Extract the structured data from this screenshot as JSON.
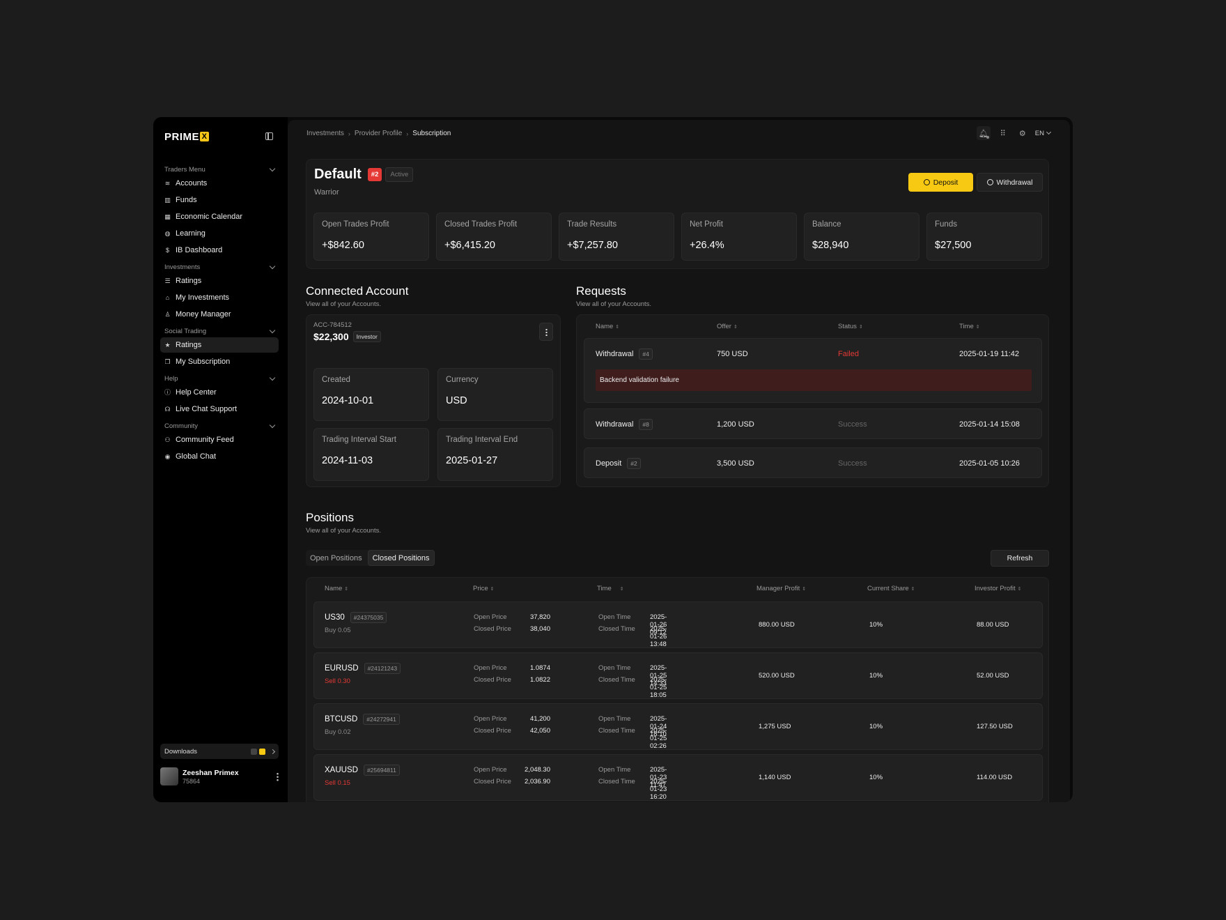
{
  "sidebar": {
    "logo_text": "PRIME",
    "logo_accent": "X",
    "sections": [
      {
        "title": "Traders Menu",
        "items": [
          {
            "label": "Accounts",
            "icon": "layers-icon"
          },
          {
            "label": "Funds",
            "icon": "chart-icon"
          },
          {
            "label": "Economic Calendar",
            "icon": "calendar-icon"
          },
          {
            "label": "Learning",
            "icon": "globe-icon"
          },
          {
            "label": "IB Dashboard",
            "icon": "dollar-icon"
          }
        ]
      },
      {
        "title": "Investments",
        "items": [
          {
            "label": "Ratings",
            "icon": "list-icon"
          },
          {
            "label": "My Investments",
            "icon": "bank-icon"
          },
          {
            "label": "Money Manager",
            "icon": "manager-icon"
          }
        ]
      },
      {
        "title": "Social Trading",
        "items": [
          {
            "label": "Ratings",
            "icon": "star-icon",
            "active": true
          },
          {
            "label": "My Subscription",
            "icon": "subscription-icon"
          }
        ]
      },
      {
        "title": "Help",
        "items": [
          {
            "label": "Help Center",
            "icon": "info-icon"
          },
          {
            "label": "Live Chat Support",
            "icon": "headset-icon"
          }
        ]
      },
      {
        "title": "Community",
        "items": [
          {
            "label": "Community Feed",
            "icon": "people-icon"
          },
          {
            "label": "Global Chat",
            "icon": "globe-chat-icon"
          }
        ]
      }
    ],
    "downloads_label": "Downloads",
    "user": {
      "name": "Zeeshan Primex",
      "id": "75864"
    }
  },
  "header": {
    "breadcrumb": [
      "Investments",
      "Provider Profile",
      "Subscription"
    ],
    "language": "EN"
  },
  "hero": {
    "title": "Default",
    "rank_badge": "#2",
    "status_badge": "Active",
    "subtitle": "Warrior",
    "deposit_label": "Deposit",
    "withdrawal_label": "Withdrawal",
    "stats": [
      {
        "label": "Open Trades Profit",
        "value": "+$842.60"
      },
      {
        "label": "Closed Trades Profit",
        "value": "+$6,415.20"
      },
      {
        "label": "Trade Results",
        "value": "+$7,257.80"
      },
      {
        "label": "Net Profit",
        "value": "+26.4%"
      },
      {
        "label": "Balance",
        "value": "$28,940"
      },
      {
        "label": "Funds",
        "value": "$27,500"
      }
    ]
  },
  "connected": {
    "title": "Connected Account",
    "subtitle": "View all of  your Accounts.",
    "account_id": "ACC-784512",
    "balance": "$22,300",
    "role": "Investor",
    "details": [
      {
        "label": "Created",
        "value": "2024-10-01"
      },
      {
        "label": "Currency",
        "value": "USD"
      },
      {
        "label": "Trading Interval Start",
        "value": "2024-11-03"
      },
      {
        "label": "Trading Interval End",
        "value": "2025-01-27"
      }
    ]
  },
  "requests": {
    "title": "Requests",
    "subtitle": "View all of  your Accounts.",
    "columns": [
      "Name",
      "Offer",
      "Status",
      "Time"
    ],
    "rows": [
      {
        "name": "Withdrawal",
        "hash": "#4",
        "offer": "750 USD",
        "status": "Failed",
        "time": "2025-01-19 11:42",
        "error": "Backend validation failure"
      },
      {
        "name": "Withdrawal",
        "hash": "#8",
        "offer": "1,200 USD",
        "status": "Success",
        "time": "2025-01-14 15:08"
      },
      {
        "name": "Deposit",
        "hash": "#2",
        "offer": "3,500 USD",
        "status": "Success",
        "time": "2025-01-05 10:26"
      }
    ]
  },
  "positions": {
    "title": "Positions",
    "subtitle": "View all of  your Accounts.",
    "tabs": [
      "Open Positions",
      "Closed Positions"
    ],
    "refresh_label": "Refresh",
    "columns": [
      "Name",
      "Price",
      "Time",
      "Manager Profit",
      "Current Share",
      "Investor Profit"
    ],
    "open_price_label": "Open Price",
    "closed_price_label": "Closed Price",
    "open_time_label": "Open Time",
    "closed_time_label": "Closed Time",
    "rows": [
      {
        "symbol": "US30",
        "ticket": "#24375035",
        "side": "Buy 0.05",
        "open_price": "37,820",
        "closed_price": "38,040",
        "open_time": "2025-01-26 09:12",
        "closed_time": "2025-01-26 13:48",
        "manager_profit": "880.00 USD",
        "share": "10%",
        "investor_profit": "88.00 USD"
      },
      {
        "symbol": "EURUSD",
        "ticket": "#24121243",
        "side": "Sell 0.30",
        "open_price": "1.0874",
        "closed_price": "1.0822",
        "open_time": "2025-01-25 14:33",
        "closed_time": "2025-01-25 18:05",
        "manager_profit": "520.00 USD",
        "share": "10%",
        "investor_profit": "52.00 USD"
      },
      {
        "symbol": "BTCUSD",
        "ticket": "#24272941",
        "side": "Buy 0.02",
        "open_price": "41,200",
        "closed_price": "42,050",
        "open_time": "2025-01-24 18:10",
        "closed_time": "2025-01-25 02:26",
        "manager_profit": "1,275 USD",
        "share": "10%",
        "investor_profit": "127.50 USD"
      },
      {
        "symbol": "XAUUSD",
        "ticket": "#25694811",
        "side": "Sell 0.15",
        "open_price": "2,048.30",
        "closed_price": "2,036.90",
        "open_time": "2025-01-23 11:47",
        "closed_time": "2025-01-23 16:20",
        "manager_profit": "1,140 USD",
        "share": "10%",
        "investor_profit": "114.00 USD"
      }
    ]
  },
  "colors": {
    "accent": "#f7c913",
    "danger": "#e53935",
    "background": "#141414"
  }
}
